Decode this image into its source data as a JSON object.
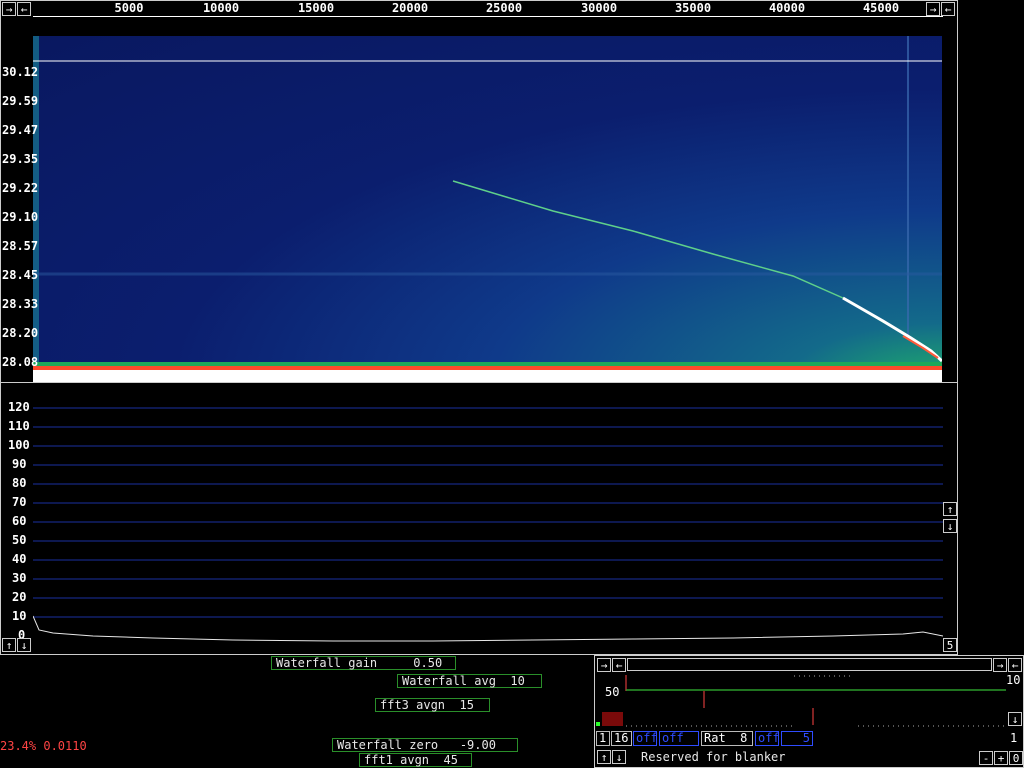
{
  "waterfall_panel": {
    "freq_ticks": [
      "5000",
      "10000",
      "15000",
      "20000",
      "25000",
      "30000",
      "35000",
      "40000",
      "45000"
    ],
    "time_ticks": [
      "30.12",
      "29.59",
      "29.47",
      "29.35",
      "29.22",
      "29.10",
      "28.57",
      "28.45",
      "28.33",
      "28.20",
      "28.08"
    ]
  },
  "spectrum_panel": {
    "y_ticks": [
      "120",
      "110",
      "100",
      "90",
      "80",
      "70",
      "60",
      "50",
      "40",
      "30",
      "20",
      "10",
      "0"
    ],
    "corner_value": "5"
  },
  "controls": {
    "waterfall_gain": "Waterfall gain     0.50",
    "waterfall_avg": "Waterfall avg  10",
    "fft3_avgn": "fft3 avgn  15",
    "waterfall_zero": "Waterfall zero   -9.00",
    "fft1_avgn": "fft1 avgn  45",
    "status": "23.4% 0.0110"
  },
  "blanker_panel": {
    "level_value": "50",
    "right_top": "10",
    "right_bottom": "1",
    "cell_1": "1",
    "cell_16": "16",
    "cell_off1": "off",
    "cell_off2": "off",
    "cell_rat": "Rat  8",
    "cell_off3": "off",
    "cell_5": "5",
    "reserved": "Reserved for blanker",
    "minus": "-",
    "plus": "+",
    "zero": "0"
  },
  "glyphs": {
    "right": "→",
    "left": "←",
    "up": "↑",
    "down": "↓"
  },
  "colors": {
    "border": "#cccccc",
    "param_border": "#2a8f2a",
    "grid": "#1a2fa0",
    "status": "#ff4444",
    "waterfall_bg": "#0b1e6e"
  }
}
